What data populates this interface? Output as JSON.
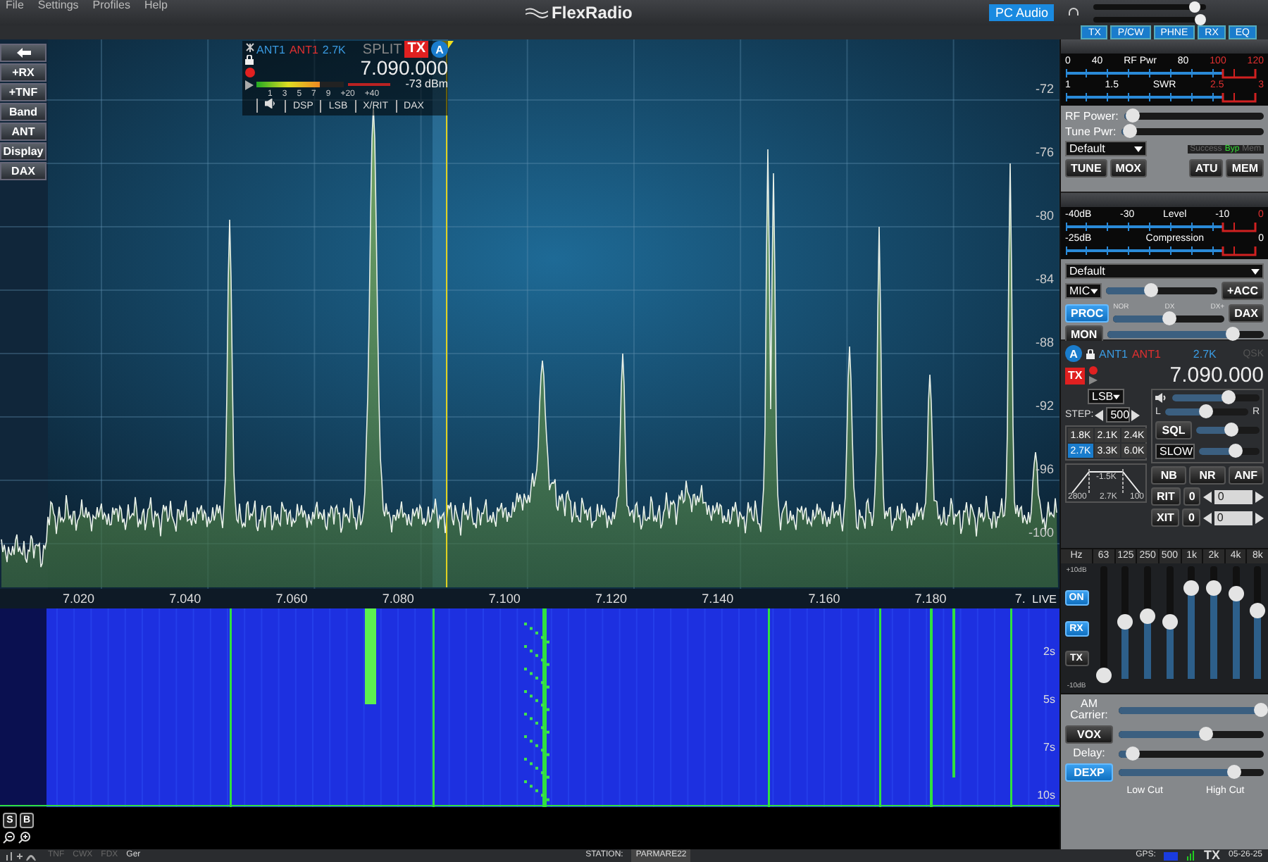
{
  "title_bar": {
    "menu": [
      "File",
      "Settings",
      "Profiles",
      "Help"
    ],
    "logo": "FlexRadio",
    "pc_audio": {
      "label": "PC Audio",
      "on": true
    },
    "sliders": [
      {
        "level": 0.9
      },
      {
        "level": 0.95
      }
    ]
  },
  "panel_tabs": [
    "TX",
    "P/CW",
    "PHNE",
    "RX",
    "EQ"
  ],
  "left_buttons": [
    "+RX",
    "+TNF",
    "Band",
    "ANT",
    "Display",
    "DAX"
  ],
  "slice_flag": {
    "rx_ant": "ANT1",
    "tx_ant": "ANT1",
    "filter": "2.7K",
    "split": "SPLIT",
    "tx": "TX",
    "letter": "A",
    "frequency": "7.090.000",
    "signal": "-73 dBm",
    "meter": {
      "level": 0.72
    },
    "scale": [
      "1",
      "3",
      "5",
      "7",
      "9",
      "+20",
      "+40"
    ],
    "tabs": [
      "DSP",
      "LSB",
      "X/RIT",
      "DAX"
    ]
  },
  "spectrum": {
    "dbm_labels": [
      "-72",
      "-76",
      "-80",
      "-84",
      "-88",
      "-92",
      "-96",
      "-100"
    ],
    "freq_labels": [
      "7.020",
      "7.040",
      "7.060",
      "7.080",
      "7.100",
      "7.120",
      "7.140",
      "7.160",
      "7.180",
      "7."
    ],
    "live": "LIVE"
  },
  "waterfall": {
    "time_labels": [
      "2s",
      "5s",
      "7s",
      "10s"
    ]
  },
  "corner_buttons": [
    "S",
    "B"
  ],
  "tx_panel": {
    "meters": [
      {
        "labels": [
          {
            "text": "0",
            "color": "#ffffff"
          },
          {
            "text": "40",
            "color": "#ffffff"
          },
          {
            "text": "RF Pwr",
            "color": "#ffffff"
          },
          {
            "text": "80",
            "color": "#ffffff"
          },
          {
            "text": "100",
            "color": "#e03030"
          },
          {
            "text": "120",
            "color": "#e03030"
          }
        ]
      },
      {
        "labels": [
          {
            "text": "1",
            "color": "#ffffff"
          },
          {
            "text": "1.5",
            "color": "#ffffff"
          },
          {
            "text": "SWR",
            "color": "#ffffff"
          },
          {
            "text": "2.5",
            "color": "#e03030"
          },
          {
            "text": "3",
            "color": "#e03030"
          }
        ]
      }
    ],
    "sliders": [
      {
        "label": "RF Power:",
        "level": 0.06
      },
      {
        "label": "Tune Pwr:",
        "level": 0.06
      }
    ],
    "profile": "Default",
    "atu_status": [
      {
        "label": "Success",
        "on": false
      },
      {
        "label": "Byp",
        "on": true
      },
      {
        "label": "Mem",
        "on": false
      }
    ],
    "buttons": [
      {
        "label": "TUNE",
        "on": false
      },
      {
        "label": "MOX",
        "on": false
      },
      {
        "label": "ATU",
        "on": false
      },
      {
        "label": "MEM",
        "on": false
      }
    ]
  },
  "phone_panel": {
    "meters": [
      {
        "labels": [
          {
            "text": "-40dB",
            "color": "#ffffff"
          },
          {
            "text": "-30",
            "color": "#ffffff"
          },
          {
            "text": "Level",
            "color": "#ffffff"
          },
          {
            "text": "-10",
            "color": "#ffffff"
          },
          {
            "text": "0",
            "color": "#e03030"
          }
        ]
      },
      {
        "labels": [
          {
            "text": "-25dB",
            "color": "#ffffff"
          },
          {
            "text": "Compression",
            "color": "#ffffff"
          },
          {
            "text": "0",
            "color": "#ffffff"
          }
        ]
      }
    ],
    "profile": "Default",
    "mic": {
      "source": "MIC",
      "level": 0.4
    },
    "acc": {
      "label": "+ACC",
      "on": false
    },
    "proc": {
      "label": "PROC",
      "on": true,
      "level": 0.5,
      "scale": [
        "NOR",
        "DX",
        "DX+"
      ]
    },
    "dax": {
      "label": "DAX",
      "on": false
    },
    "mon": {
      "label": "MON",
      "on": false,
      "level": 0.8
    }
  },
  "rx_panel": {
    "letter": "A",
    "rx_ant": "ANT1",
    "tx_ant": "ANT1",
    "filter": "2.7K",
    "qsk": "QSK",
    "tx": "TX",
    "frequency": "7.090.000",
    "mode": "LSB",
    "step_label": "STEP:",
    "step": "500",
    "filters": [
      {
        "label": "1.8K",
        "selected": false
      },
      {
        "label": "2.1K",
        "selected": false
      },
      {
        "label": "2.4K",
        "selected": false
      },
      {
        "label": "2.7K",
        "selected": true
      },
      {
        "label": "3.3K",
        "selected": false
      },
      {
        "label": "6.0K",
        "selected": false
      }
    ],
    "filter_graph": {
      "center": "-1.5K",
      "low": "2800",
      "width": "2.7K",
      "high": "100"
    },
    "audio": {
      "gain": {
        "level": 0.65
      },
      "pan": {
        "level": 0.5
      },
      "left": "L",
      "right": "R"
    },
    "sql": {
      "label": "SQL",
      "level": 0.55
    },
    "agc": {
      "label": "SLOW",
      "level": 0.6
    },
    "dsp": [
      {
        "label": "NB",
        "on": false
      },
      {
        "label": "NR",
        "on": false
      },
      {
        "label": "ANF",
        "on": false
      }
    ],
    "offsets": [
      {
        "label": "RIT",
        "toggle": "0",
        "value": "0"
      },
      {
        "label": "XIT",
        "toggle": "0",
        "value": "0"
      }
    ]
  },
  "eq": {
    "unit": "Hz",
    "max": "+10dB",
    "min": "-10dB",
    "buttons": [
      {
        "label": "ON",
        "on": true
      },
      {
        "label": "RX",
        "on": true
      },
      {
        "label": "TX",
        "on": false
      }
    ],
    "bands": [
      {
        "label": "63",
        "level": 0.03
      },
      {
        "label": "125",
        "level": 0.5
      },
      {
        "label": "250",
        "level": 0.55
      },
      {
        "label": "500",
        "level": 0.5
      },
      {
        "label": "1k",
        "level": 0.8
      },
      {
        "label": "2k",
        "level": 0.8
      },
      {
        "label": "4k",
        "level": 0.75
      },
      {
        "label": "8k",
        "level": 0.6
      }
    ]
  },
  "tx_audio": {
    "rows": [
      {
        "kind": "label",
        "label": "AM Carrier:",
        "level": 0.98
      },
      {
        "kind": "button",
        "label": "VOX",
        "on": false,
        "level": 0.6
      },
      {
        "kind": "label",
        "label": "Delay:",
        "level": 0.1
      },
      {
        "kind": "button",
        "label": "DEXP",
        "on": true,
        "level": 0.8
      }
    ],
    "cut_labels": [
      "Low Cut",
      "High Cut"
    ]
  },
  "status_bar": {
    "features": [
      "TNF",
      "CWX",
      "FDX"
    ],
    "user": "Ger",
    "station_label": "STATION:",
    "station": "PARMARE22",
    "gps_label": "GPS:",
    "tx": "TX",
    "date": "05-26-25"
  }
}
